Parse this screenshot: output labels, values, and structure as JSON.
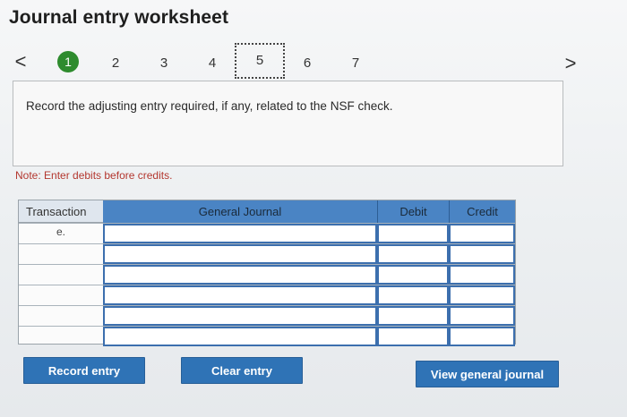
{
  "title": "Journal entry worksheet",
  "steps": [
    "1",
    "2",
    "3",
    "4",
    "5",
    "6",
    "7"
  ],
  "nav": {
    "prev": "<",
    "next": ">"
  },
  "instruction": "Record the adjusting entry required, if any, related to the NSF check.",
  "note": "Note: Enter debits before credits.",
  "journal": {
    "headers": {
      "transaction": "Transaction",
      "general_journal": "General Journal",
      "debit": "Debit",
      "credit": "Credit"
    },
    "rows": [
      {
        "transaction": "e."
      },
      {
        "transaction": ""
      },
      {
        "transaction": ""
      },
      {
        "transaction": ""
      },
      {
        "transaction": ""
      },
      {
        "transaction": ""
      }
    ]
  },
  "buttons": {
    "record": "Record entry",
    "clear": "Clear entry",
    "view": "View general journal"
  },
  "colors": {
    "accent": "#2f73b6",
    "active_step": "#2e8b2e",
    "note": "#b3372f"
  }
}
